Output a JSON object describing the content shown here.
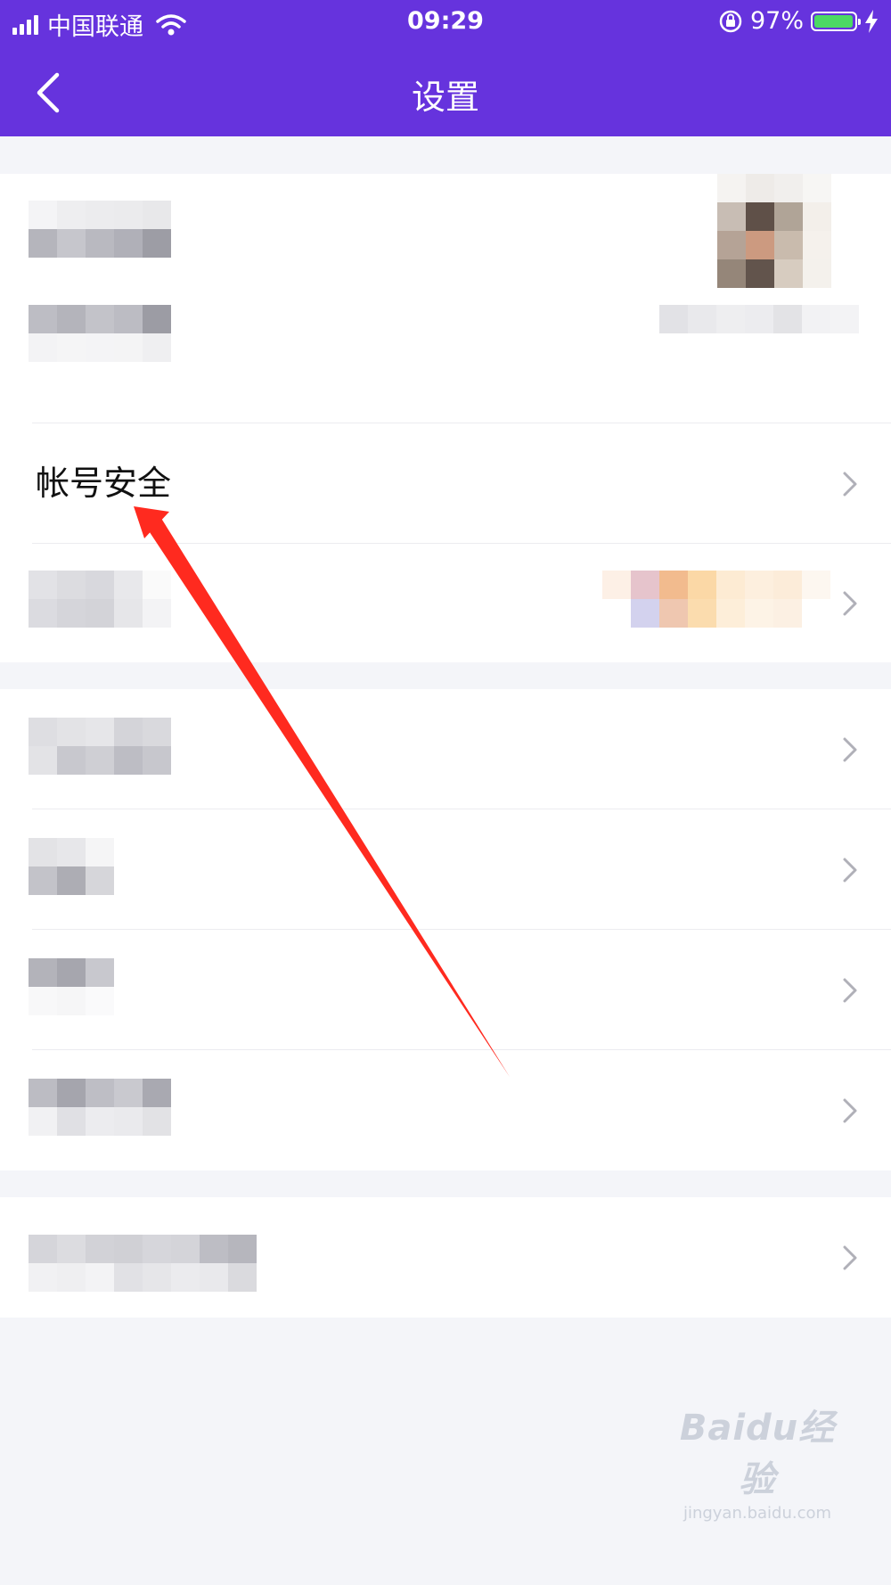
{
  "status_bar": {
    "carrier": "中国联通",
    "time": "09:29",
    "battery": "97%",
    "battery_level": 0.97
  },
  "header": {
    "title": "设置",
    "back_icon": "chevron-left-icon"
  },
  "rows": {
    "account_security": {
      "label": "帐号安全"
    }
  },
  "colors": {
    "header_bg": "#6633dd",
    "page_bg": "#f4f5f9",
    "annotation_arrow": "#ff2a1f"
  },
  "watermark": {
    "logo": "Baidu经验",
    "url": "jingyan.baidu.com"
  }
}
